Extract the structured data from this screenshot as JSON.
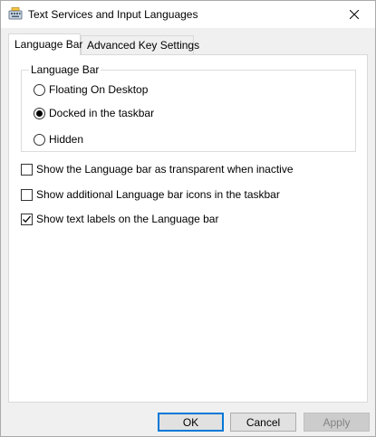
{
  "window": {
    "title": "Text Services and Input Languages",
    "icons": {
      "app": "keyboard-icon",
      "close": "close-icon"
    }
  },
  "tabs": [
    {
      "label": "Language Bar",
      "active": true
    },
    {
      "label": "Advanced Key Settings",
      "active": false
    }
  ],
  "language_bar_group": {
    "title": "Language Bar",
    "options": [
      {
        "label": "Floating On Desktop",
        "checked": false
      },
      {
        "label": "Docked in the taskbar",
        "checked": true
      },
      {
        "label": "Hidden",
        "checked": false
      }
    ]
  },
  "checkboxes": [
    {
      "label": "Show the Language bar as transparent when inactive",
      "checked": false
    },
    {
      "label": "Show additional Language bar icons in the taskbar",
      "checked": false
    },
    {
      "label": "Show text labels on the Language bar",
      "checked": true
    }
  ],
  "buttons": {
    "ok": "OK",
    "cancel": "Cancel",
    "apply": "Apply"
  },
  "colors": {
    "accent": "#0078d7",
    "window_bg": "#f0f0f0",
    "panel_bg": "#ffffff",
    "disabled_text": "#838383"
  }
}
